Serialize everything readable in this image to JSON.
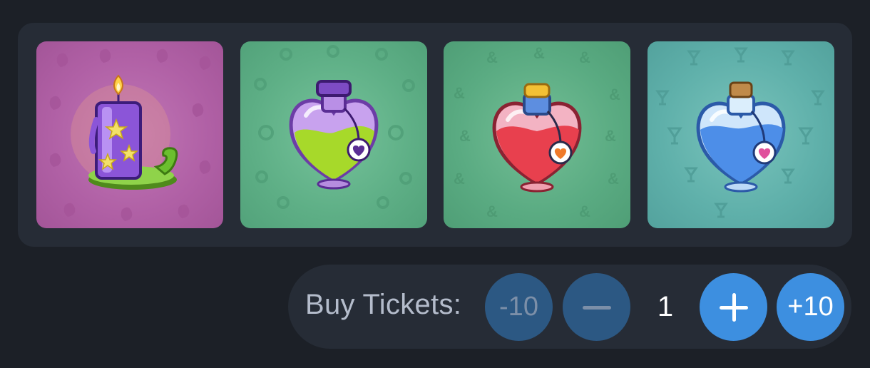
{
  "items": [
    {
      "name": "candle-icon",
      "bg": "#b060a5"
    },
    {
      "name": "green-heart-potion-icon",
      "bg": "#5eaf86"
    },
    {
      "name": "red-heart-potion-icon",
      "bg": "#5aab82"
    },
    {
      "name": "blue-heart-potion-icon",
      "bg": "#5fb0aa"
    }
  ],
  "tickets": {
    "label": "Buy Tickets:",
    "minus10_label": "-10",
    "plus10_label": "+10",
    "quantity": "1",
    "minus_icon": "minus-icon",
    "plus_icon": "plus-icon"
  },
  "colors": {
    "background": "#1c2027",
    "panel": "#262c36",
    "button_active": "#3d8fe0",
    "button_disabled": "#2c5883"
  }
}
